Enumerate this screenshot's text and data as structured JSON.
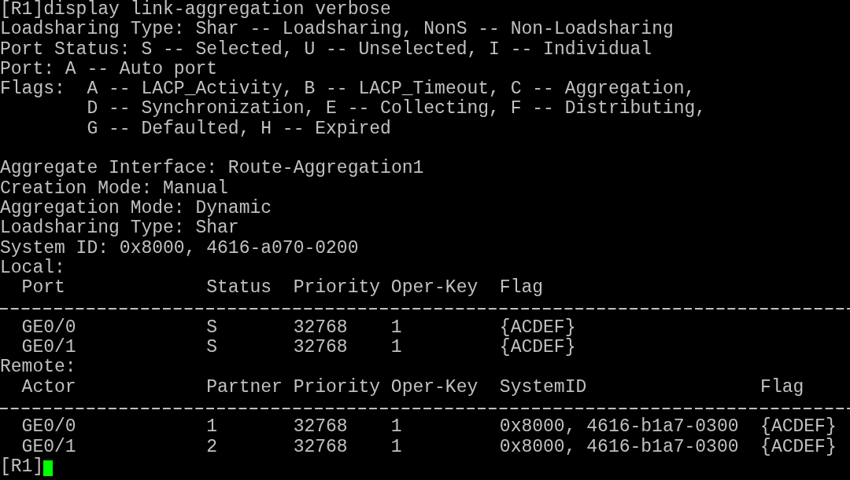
{
  "terminal": {
    "blocks": [
      {
        "kind": "line",
        "text": "[R1]display link-aggregation verbose"
      },
      {
        "kind": "line",
        "text": "Loadsharing Type: Shar -- Loadsharing, NonS -- Non-Loadsharing"
      },
      {
        "kind": "line",
        "text": "Port Status: S -- Selected, U -- Unselected, I -- Individual"
      },
      {
        "kind": "line",
        "text": "Port: A -- Auto port"
      },
      {
        "kind": "line",
        "text": "Flags:  A -- LACP_Activity, B -- LACP_Timeout, C -- Aggregation,"
      },
      {
        "kind": "line",
        "text": "        D -- Synchronization, E -- Collecting, F -- Distributing,"
      },
      {
        "kind": "line",
        "text": "        G -- Defaulted, H -- Expired"
      },
      {
        "kind": "blank"
      },
      {
        "kind": "line",
        "text": "Aggregate Interface: Route-Aggregation1"
      },
      {
        "kind": "line",
        "text": "Creation Mode: Manual"
      },
      {
        "kind": "line",
        "text": "Aggregation Mode: Dynamic"
      },
      {
        "kind": "line",
        "text": "Loadsharing Type: Shar"
      },
      {
        "kind": "line",
        "text": "System ID: 0x8000, 4616-a070-0200"
      },
      {
        "kind": "line",
        "text": "Local:"
      },
      {
        "kind": "table",
        "columns": [
          "Port",
          "Status",
          "Priority",
          "Oper-Key",
          "Flag"
        ],
        "rows": [
          [
            "GE0/0",
            "S",
            "32768",
            "1",
            "{ACDEF}"
          ],
          [
            "GE0/1",
            "S",
            "32768",
            "1",
            "{ACDEF}"
          ]
        ]
      },
      {
        "kind": "line",
        "text": "Remote:"
      },
      {
        "kind": "table",
        "columns": [
          "Actor",
          "Partner",
          "Priority",
          "Oper-Key",
          "SystemID",
          "Flag"
        ],
        "rows": [
          [
            "GE0/0",
            "1",
            "32768",
            "1",
            "0x8000, 4616-b1a7-0300",
            "{ACDEF}"
          ],
          [
            "GE0/1",
            "2",
            "32768",
            "1",
            "0x8000, 4616-b1a7-0300",
            "{ACDEF}"
          ]
        ]
      },
      {
        "kind": "prompt",
        "text": "[R1]"
      }
    ]
  }
}
